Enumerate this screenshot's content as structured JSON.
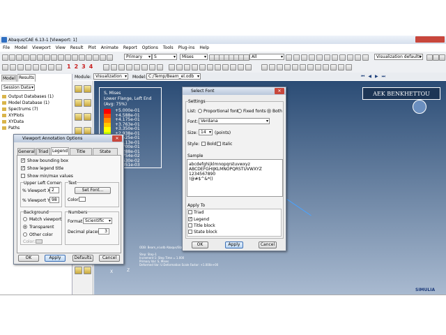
{
  "window": {
    "title": "Abaqus/CAE 6.13-1 [Viewport: 1]"
  },
  "menubar": [
    "File",
    "Model",
    "Viewport",
    "View",
    "Result",
    "Plot",
    "Animate",
    "Report",
    "Options",
    "Tools",
    "Plug-ins",
    "Help"
  ],
  "toolbar": {
    "step_select": "Primary",
    "var_select": "S",
    "comp_select": "Mises",
    "all_select": "All",
    "vis_defaults": "Visualization defaults",
    "numbers": [
      "1",
      "2",
      "3",
      "4"
    ]
  },
  "context": {
    "module_label": "Module:",
    "module_value": "Visualization",
    "model_label": "Model:",
    "model_value": "C:/Temp/Beam_el.odb"
  },
  "tree": {
    "tabs": [
      "Model",
      "Results"
    ],
    "filter": "Session Data",
    "items": [
      "Output Databases (1)",
      "Model Database (1)",
      "Spectrums (7)",
      "XYPlots",
      "XYData",
      "Paths"
    ]
  },
  "legend": {
    "title1": "S, Mises",
    "title2": "Lower Flange, Left End",
    "title3": "(Avg: 75%)",
    "values": [
      "+5.000e-01",
      "+4.588e-01",
      "+4.175e-01",
      "+3.763e-01",
      "+3.350e-01",
      "+2.938e-01",
      "+2.525e-01",
      "+2.113e-01",
      "+1.700e-01",
      "+1.288e-01",
      "+8.754e-02",
      "+4.630e-02",
      "+5.051e-03"
    ],
    "colors": [
      "#ff0000",
      "#ff4a00",
      "#ff8c00",
      "#ffc800",
      "#ffff00",
      "#c8ff00",
      "#7fff00",
      "#00ff3c",
      "#00ffa0",
      "#00e6ff",
      "#0096ff",
      "#0046ff",
      "#0000ff"
    ]
  },
  "brand": {
    "banner": "AEK BENKHETTOU",
    "simulia": "SIMULIA"
  },
  "viewport_text": {
    "odb": "ODB: Beam_el.odb   Abaqus/Standard 6.13-1",
    "lines": [
      "Step: Step-1",
      "Increment  1: Step Time =    1.000",
      "Primary Var: S, Mises",
      "Deformed Var: U   Deformation Scale Factor: +1.000e+00"
    ],
    "axis_x": "X",
    "axis_z": "Z"
  },
  "annot_dialog": {
    "title": "Viewport Annotation Options",
    "tabs": [
      "General",
      "Triad",
      "Legend",
      "Title Block",
      "State Block"
    ],
    "show_bounding_box": "Show bounding box",
    "show_legend_title": "Show legend title",
    "show_minmax": "Show min/max values",
    "upper_left": "Upper Left Corner",
    "viewport_x_label": "% Viewport X:",
    "viewport_x": "2",
    "viewport_y_label": "% Viewport Y:",
    "viewport_y": "98",
    "text_group": "Text",
    "set_font": "Set Font...",
    "color_label": "Color:",
    "background_group": "Background",
    "bg_options": [
      "Match viewport",
      "Transparent",
      "Other color"
    ],
    "bg_color_label": "Color:",
    "numbers_group": "Numbers",
    "format_label": "Format:",
    "format_value": "Scientific",
    "decimal_label": "Decimal places:",
    "decimal_value": "3",
    "ok": "OK",
    "apply": "Apply",
    "defaults": "Defaults",
    "cancel": "Cancel"
  },
  "font_dialog": {
    "title": "Select Font",
    "settings": "Settings",
    "list_label": "List:",
    "list_options": [
      "Proportional fonts",
      "Fixed fonts",
      "Both"
    ],
    "font_label": "Font:",
    "font_value": "Verdana",
    "size_label": "Size:",
    "size_value": "14",
    "size_unit": "(points)",
    "style_label": "Style:",
    "bold": "Bold",
    "italic": "Italic",
    "sample": "Sample",
    "sample_lines": [
      "abcdefghijklmnopqrstuvwxyz",
      "ABCDEFGHIJKLMNOPQRSTUVWXYZ",
      "1234567890",
      "!@#$^&*()"
    ],
    "apply_to": "Apply To",
    "apply_items": [
      "Triad",
      "Legend",
      "Title block",
      "State block"
    ],
    "ok": "OK",
    "apply": "Apply",
    "cancel": "Cancel"
  }
}
